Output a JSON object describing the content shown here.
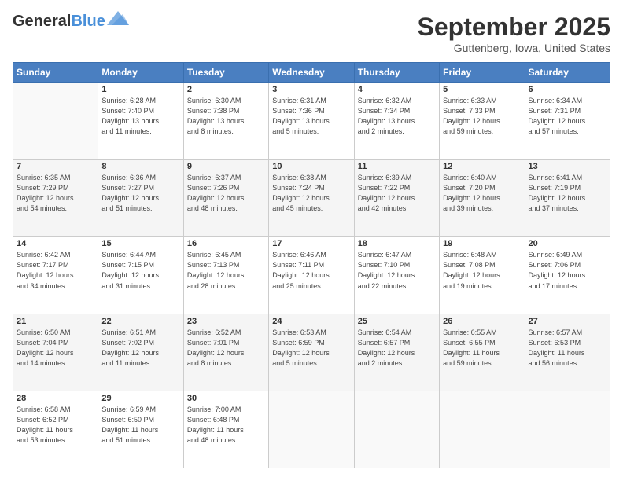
{
  "header": {
    "logo_line1": "General",
    "logo_line2": "Blue",
    "month": "September 2025",
    "location": "Guttenberg, Iowa, United States"
  },
  "weekdays": [
    "Sunday",
    "Monday",
    "Tuesday",
    "Wednesday",
    "Thursday",
    "Friday",
    "Saturday"
  ],
  "weeks": [
    [
      {
        "day": "",
        "info": ""
      },
      {
        "day": "1",
        "info": "Sunrise: 6:28 AM\nSunset: 7:40 PM\nDaylight: 13 hours\nand 11 minutes."
      },
      {
        "day": "2",
        "info": "Sunrise: 6:30 AM\nSunset: 7:38 PM\nDaylight: 13 hours\nand 8 minutes."
      },
      {
        "day": "3",
        "info": "Sunrise: 6:31 AM\nSunset: 7:36 PM\nDaylight: 13 hours\nand 5 minutes."
      },
      {
        "day": "4",
        "info": "Sunrise: 6:32 AM\nSunset: 7:34 PM\nDaylight: 13 hours\nand 2 minutes."
      },
      {
        "day": "5",
        "info": "Sunrise: 6:33 AM\nSunset: 7:33 PM\nDaylight: 12 hours\nand 59 minutes."
      },
      {
        "day": "6",
        "info": "Sunrise: 6:34 AM\nSunset: 7:31 PM\nDaylight: 12 hours\nand 57 minutes."
      }
    ],
    [
      {
        "day": "7",
        "info": "Sunrise: 6:35 AM\nSunset: 7:29 PM\nDaylight: 12 hours\nand 54 minutes."
      },
      {
        "day": "8",
        "info": "Sunrise: 6:36 AM\nSunset: 7:27 PM\nDaylight: 12 hours\nand 51 minutes."
      },
      {
        "day": "9",
        "info": "Sunrise: 6:37 AM\nSunset: 7:26 PM\nDaylight: 12 hours\nand 48 minutes."
      },
      {
        "day": "10",
        "info": "Sunrise: 6:38 AM\nSunset: 7:24 PM\nDaylight: 12 hours\nand 45 minutes."
      },
      {
        "day": "11",
        "info": "Sunrise: 6:39 AM\nSunset: 7:22 PM\nDaylight: 12 hours\nand 42 minutes."
      },
      {
        "day": "12",
        "info": "Sunrise: 6:40 AM\nSunset: 7:20 PM\nDaylight: 12 hours\nand 39 minutes."
      },
      {
        "day": "13",
        "info": "Sunrise: 6:41 AM\nSunset: 7:19 PM\nDaylight: 12 hours\nand 37 minutes."
      }
    ],
    [
      {
        "day": "14",
        "info": "Sunrise: 6:42 AM\nSunset: 7:17 PM\nDaylight: 12 hours\nand 34 minutes."
      },
      {
        "day": "15",
        "info": "Sunrise: 6:44 AM\nSunset: 7:15 PM\nDaylight: 12 hours\nand 31 minutes."
      },
      {
        "day": "16",
        "info": "Sunrise: 6:45 AM\nSunset: 7:13 PM\nDaylight: 12 hours\nand 28 minutes."
      },
      {
        "day": "17",
        "info": "Sunrise: 6:46 AM\nSunset: 7:11 PM\nDaylight: 12 hours\nand 25 minutes."
      },
      {
        "day": "18",
        "info": "Sunrise: 6:47 AM\nSunset: 7:10 PM\nDaylight: 12 hours\nand 22 minutes."
      },
      {
        "day": "19",
        "info": "Sunrise: 6:48 AM\nSunset: 7:08 PM\nDaylight: 12 hours\nand 19 minutes."
      },
      {
        "day": "20",
        "info": "Sunrise: 6:49 AM\nSunset: 7:06 PM\nDaylight: 12 hours\nand 17 minutes."
      }
    ],
    [
      {
        "day": "21",
        "info": "Sunrise: 6:50 AM\nSunset: 7:04 PM\nDaylight: 12 hours\nand 14 minutes."
      },
      {
        "day": "22",
        "info": "Sunrise: 6:51 AM\nSunset: 7:02 PM\nDaylight: 12 hours\nand 11 minutes."
      },
      {
        "day": "23",
        "info": "Sunrise: 6:52 AM\nSunset: 7:01 PM\nDaylight: 12 hours\nand 8 minutes."
      },
      {
        "day": "24",
        "info": "Sunrise: 6:53 AM\nSunset: 6:59 PM\nDaylight: 12 hours\nand 5 minutes."
      },
      {
        "day": "25",
        "info": "Sunrise: 6:54 AM\nSunset: 6:57 PM\nDaylight: 12 hours\nand 2 minutes."
      },
      {
        "day": "26",
        "info": "Sunrise: 6:55 AM\nSunset: 6:55 PM\nDaylight: 11 hours\nand 59 minutes."
      },
      {
        "day": "27",
        "info": "Sunrise: 6:57 AM\nSunset: 6:53 PM\nDaylight: 11 hours\nand 56 minutes."
      }
    ],
    [
      {
        "day": "28",
        "info": "Sunrise: 6:58 AM\nSunset: 6:52 PM\nDaylight: 11 hours\nand 53 minutes."
      },
      {
        "day": "29",
        "info": "Sunrise: 6:59 AM\nSunset: 6:50 PM\nDaylight: 11 hours\nand 51 minutes."
      },
      {
        "day": "30",
        "info": "Sunrise: 7:00 AM\nSunset: 6:48 PM\nDaylight: 11 hours\nand 48 minutes."
      },
      {
        "day": "",
        "info": ""
      },
      {
        "day": "",
        "info": ""
      },
      {
        "day": "",
        "info": ""
      },
      {
        "day": "",
        "info": ""
      }
    ]
  ]
}
